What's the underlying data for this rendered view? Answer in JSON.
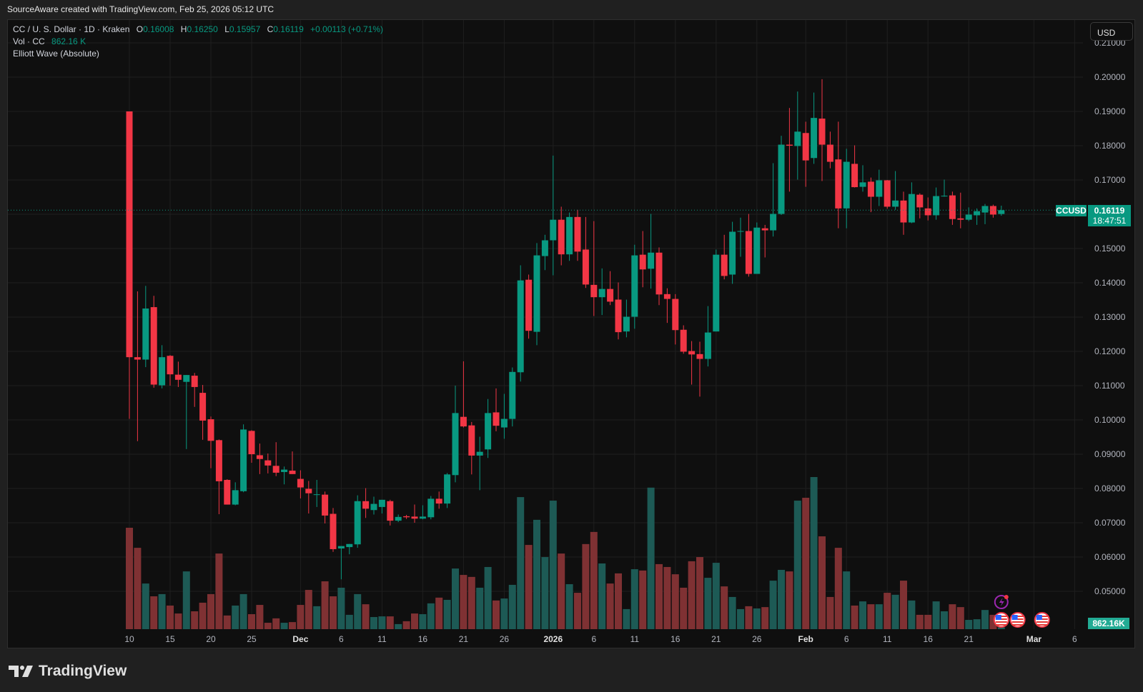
{
  "topbar": {
    "attribution": "SourceAware created with TradingView.com, Feb 25, 2026 05:12 UTC"
  },
  "legend": {
    "symbol_line": "CC / U. S. Dollar · 1D · Kraken",
    "o_label": "O",
    "o": "0.16008",
    "h_label": "H",
    "h": "0.16250",
    "l_label": "L",
    "l": "0.15957",
    "c_label": "C",
    "c": "0.16119",
    "change": "+0.00113 (+0.71%)",
    "vol_label": "Vol · CC",
    "vol": "862.16 K",
    "indicator": "Elliott Wave (Absolute)"
  },
  "currency_button": "USD",
  "last_price": {
    "symbol": "CCUSD",
    "price": "0.16119",
    "countdown": "18:47:51"
  },
  "last_volume": "862.16K",
  "brand": "TradingView",
  "colors": {
    "up": "#089981",
    "down": "#f23645",
    "up_vol": "#1d5a55",
    "down_vol": "#7f3133",
    "bg": "#0f0f0f",
    "grid": "#1f1f1f"
  },
  "chart_data": {
    "type": "candlestick",
    "symbol": "CCUSD",
    "interval": "1D",
    "start_date": "Nov 10 2025",
    "ylim": [
      0.05,
      0.21
    ],
    "yticks": [
      "0.05000",
      "0.06000",
      "0.07000",
      "0.08000",
      "0.09000",
      "0.10000",
      "0.11000",
      "0.12000",
      "0.13000",
      "0.14000",
      "0.15000",
      "0.16000",
      "0.17000",
      "0.18000",
      "0.19000",
      "0.20000",
      "0.21000"
    ],
    "xticks": [
      {
        "label": "10",
        "day": 0
      },
      {
        "label": "15",
        "day": 5
      },
      {
        "label": "20",
        "day": 10
      },
      {
        "label": "25",
        "day": 15
      },
      {
        "label": "Dec",
        "day": 21,
        "major": true
      },
      {
        "label": "6",
        "day": 26
      },
      {
        "label": "11",
        "day": 31
      },
      {
        "label": "16",
        "day": 36
      },
      {
        "label": "21",
        "day": 41
      },
      {
        "label": "26",
        "day": 46
      },
      {
        "label": "2026",
        "day": 52,
        "major": true
      },
      {
        "label": "6",
        "day": 57
      },
      {
        "label": "11",
        "day": 62
      },
      {
        "label": "16",
        "day": 67
      },
      {
        "label": "21",
        "day": 72
      },
      {
        "label": "26",
        "day": 77
      },
      {
        "label": "Feb",
        "day": 83,
        "major": true
      },
      {
        "label": "6",
        "day": 88
      },
      {
        "label": "11",
        "day": 93
      },
      {
        "label": "16",
        "day": 98
      },
      {
        "label": "21",
        "day": 103
      },
      {
        "label": "Mar",
        "day": 111,
        "major": true
      },
      {
        "label": "6",
        "day": 116
      }
    ],
    "ohlc_columns": [
      "open",
      "high",
      "low",
      "close"
    ],
    "ohlc": [
      [
        0.19,
        0.19,
        0.1003,
        0.1183
      ],
      [
        0.1183,
        0.1375,
        0.0938,
        0.1176
      ],
      [
        0.1176,
        0.1391,
        0.1154,
        0.1325
      ],
      [
        0.1329,
        0.1362,
        0.1094,
        0.1103
      ],
      [
        0.1101,
        0.1218,
        0.1092,
        0.1183
      ],
      [
        0.1187,
        0.1189,
        0.11,
        0.1133
      ],
      [
        0.1132,
        0.117,
        0.1096,
        0.1117
      ],
      [
        0.1111,
        0.1131,
        0.0915,
        0.1131
      ],
      [
        0.1129,
        0.1137,
        0.1038,
        0.1096
      ],
      [
        0.1079,
        0.1102,
        0.0942,
        0.0998
      ],
      [
        0.1002,
        0.101,
        0.0859,
        0.0939
      ],
      [
        0.0941,
        0.0943,
        0.0725,
        0.0821
      ],
      [
        0.0825,
        0.0827,
        0.0753,
        0.0753
      ],
      [
        0.0753,
        0.0818,
        0.0751,
        0.0795
      ],
      [
        0.0792,
        0.0987,
        0.0789,
        0.0972
      ],
      [
        0.0968,
        0.097,
        0.0875,
        0.09
      ],
      [
        0.0897,
        0.0931,
        0.0842,
        0.0886
      ],
      [
        0.0882,
        0.0902,
        0.0844,
        0.0867
      ],
      [
        0.0866,
        0.0935,
        0.0836,
        0.0846
      ],
      [
        0.0848,
        0.0864,
        0.0812,
        0.0855
      ],
      [
        0.0852,
        0.0908,
        0.0842,
        0.0842
      ],
      [
        0.0828,
        0.0853,
        0.0771,
        0.0803
      ],
      [
        0.0799,
        0.0822,
        0.0727,
        0.0786
      ],
      [
        0.0782,
        0.0825,
        0.0746,
        0.0783
      ],
      [
        0.0782,
        0.0791,
        0.0698,
        0.0721
      ],
      [
        0.0726,
        0.0743,
        0.0615,
        0.0623
      ],
      [
        0.0625,
        0.0632,
        0.0535,
        0.0632
      ],
      [
        0.0629,
        0.0638,
        0.0608,
        0.0638
      ],
      [
        0.0637,
        0.078,
        0.0627,
        0.0763
      ],
      [
        0.0763,
        0.0801,
        0.0714,
        0.0741
      ],
      [
        0.0737,
        0.0776,
        0.0724,
        0.0755
      ],
      [
        0.0746,
        0.0767,
        0.0727,
        0.0767
      ],
      [
        0.0763,
        0.0767,
        0.0692,
        0.0706
      ],
      [
        0.0706,
        0.0724,
        0.0702,
        0.0717
      ],
      [
        0.0719,
        0.0723,
        0.0711,
        0.0716
      ],
      [
        0.0718,
        0.0753,
        0.07,
        0.0712
      ],
      [
        0.0712,
        0.0751,
        0.071,
        0.0718
      ],
      [
        0.0716,
        0.0778,
        0.071,
        0.077
      ],
      [
        0.077,
        0.0791,
        0.0741,
        0.0756
      ],
      [
        0.0756,
        0.0845,
        0.0743,
        0.0841
      ],
      [
        0.0839,
        0.11,
        0.0818,
        0.102
      ],
      [
        0.1009,
        0.1171,
        0.0978,
        0.0981
      ],
      [
        0.0984,
        0.0994,
        0.0841,
        0.0896
      ],
      [
        0.0896,
        0.0951,
        0.0795,
        0.0907
      ],
      [
        0.0914,
        0.1061,
        0.0889,
        0.102
      ],
      [
        0.1022,
        0.1092,
        0.0967,
        0.0983
      ],
      [
        0.0978,
        0.1076,
        0.0945,
        0.1003
      ],
      [
        0.1003,
        0.1153,
        0.0981,
        0.114
      ],
      [
        0.1139,
        0.1451,
        0.1112,
        0.1407
      ],
      [
        0.1409,
        0.1424,
        0.1237,
        0.126
      ],
      [
        0.1257,
        0.1516,
        0.1218,
        0.148
      ],
      [
        0.1478,
        0.154,
        0.1437,
        0.1524
      ],
      [
        0.1524,
        0.1771,
        0.1422,
        0.1584
      ],
      [
        0.1584,
        0.1622,
        0.1451,
        0.1483
      ],
      [
        0.1483,
        0.1605,
        0.1464,
        0.1592
      ],
      [
        0.1592,
        0.1613,
        0.1464,
        0.1491
      ],
      [
        0.1497,
        0.1592,
        0.1385,
        0.1395
      ],
      [
        0.1394,
        0.158,
        0.1303,
        0.1358
      ],
      [
        0.1358,
        0.1442,
        0.1306,
        0.1382
      ],
      [
        0.1382,
        0.1434,
        0.1335,
        0.1345
      ],
      [
        0.1351,
        0.1401,
        0.1235,
        0.1256
      ],
      [
        0.1258,
        0.1351,
        0.1241,
        0.1301
      ],
      [
        0.1301,
        0.1511,
        0.1266,
        0.148
      ],
      [
        0.1482,
        0.1551,
        0.1387,
        0.1439
      ],
      [
        0.1441,
        0.1601,
        0.1383,
        0.1488
      ],
      [
        0.1488,
        0.1503,
        0.1335,
        0.1366
      ],
      [
        0.1367,
        0.1384,
        0.1283,
        0.1353
      ],
      [
        0.1353,
        0.1367,
        0.122,
        0.1262
      ],
      [
        0.1263,
        0.1276,
        0.1193,
        0.1199
      ],
      [
        0.1201,
        0.123,
        0.1103,
        0.1191
      ],
      [
        0.1192,
        0.1228,
        0.1068,
        0.1178
      ],
      [
        0.1178,
        0.1332,
        0.1156,
        0.1255
      ],
      [
        0.1258,
        0.1497,
        0.1258,
        0.1482
      ],
      [
        0.1482,
        0.154,
        0.141,
        0.142
      ],
      [
        0.1424,
        0.1578,
        0.1397,
        0.1549
      ],
      [
        0.155,
        0.159,
        0.1476,
        0.1551
      ],
      [
        0.1551,
        0.1601,
        0.1418,
        0.1426
      ],
      [
        0.1426,
        0.1576,
        0.1426,
        0.1561
      ],
      [
        0.1559,
        0.1569,
        0.1474,
        0.1553
      ],
      [
        0.1553,
        0.1749,
        0.1535,
        0.1601
      ],
      [
        0.1601,
        0.1829,
        0.1598,
        0.1803
      ],
      [
        0.1803,
        0.191,
        0.1666,
        0.18
      ],
      [
        0.1799,
        0.1958,
        0.1701,
        0.1841
      ],
      [
        0.1837,
        0.187,
        0.168,
        0.1757
      ],
      [
        0.1764,
        0.1955,
        0.1747,
        0.1881
      ],
      [
        0.1879,
        0.1994,
        0.1697,
        0.1803
      ],
      [
        0.1803,
        0.1841,
        0.1734,
        0.1753
      ],
      [
        0.176,
        0.187,
        0.1559,
        0.1617
      ],
      [
        0.1617,
        0.1791,
        0.1559,
        0.1753
      ],
      [
        0.1747,
        0.1801,
        0.1678,
        0.1679
      ],
      [
        0.168,
        0.1743,
        0.1666,
        0.1693
      ],
      [
        0.1695,
        0.1707,
        0.1606,
        0.1651
      ],
      [
        0.1651,
        0.173,
        0.1624,
        0.1699
      ],
      [
        0.1699,
        0.17,
        0.1616,
        0.1622
      ],
      [
        0.1622,
        0.1726,
        0.1613,
        0.164
      ],
      [
        0.164,
        0.1666,
        0.154,
        0.1576
      ],
      [
        0.1576,
        0.1693,
        0.1574,
        0.1659
      ],
      [
        0.1657,
        0.1661,
        0.1588,
        0.162
      ],
      [
        0.1617,
        0.1649,
        0.1582,
        0.1597
      ],
      [
        0.1597,
        0.1678,
        0.1584,
        0.1653
      ],
      [
        0.1653,
        0.1701,
        0.1651,
        0.1654
      ],
      [
        0.1655,
        0.1666,
        0.1569,
        0.1586
      ],
      [
        0.1588,
        0.1663,
        0.1559,
        0.1584
      ],
      [
        0.1584,
        0.162,
        0.158,
        0.1599
      ],
      [
        0.1597,
        0.1617,
        0.1569,
        0.1609
      ],
      [
        0.1605,
        0.163,
        0.1571,
        0.1624
      ],
      [
        0.1624,
        0.1628,
        0.159,
        0.1599
      ],
      [
        0.16008,
        0.1625,
        0.15957,
        0.16119
      ]
    ],
    "volume_unit": "M CC",
    "volume": [
      46.0,
      36.9,
      20.7,
      14.9,
      15.9,
      10.7,
      7.1,
      26.2,
      8.1,
      12.0,
      15.9,
      34.3,
      6.2,
      10.7,
      15.9,
      6.8,
      11.0,
      2.9,
      4.9,
      2.9,
      3.2,
      11.0,
      17.8,
      10.4,
      21.7,
      14.9,
      18.8,
      6.5,
      15.9,
      11.3,
      5.5,
      5.8,
      5.8,
      2.3,
      3.6,
      7.1,
      6.8,
      11.7,
      14.3,
      13.3,
      27.5,
      24.6,
      23.7,
      18.8,
      28.2,
      13.0,
      13.9,
      20.1,
      59.9,
      38.2,
      49.6,
      32.7,
      58.3,
      34.3,
      20.4,
      16.5,
      38.6,
      44.1,
      29.8,
      20.7,
      25.3,
      9.1,
      27.2,
      26.6,
      64.2,
      29.5,
      28.2,
      24.9,
      18.8,
      30.8,
      32.7,
      23.3,
      30.1,
      19.4,
      14.6,
      9.1,
      10.4,
      9.4,
      10.0,
      22.0,
      26.9,
      26.2,
      58.3,
      59.6,
      69.0,
      42.1,
      14.6,
      36.9,
      26.2,
      10.7,
      12.6,
      11.3,
      11.3,
      16.5,
      15.6,
      22.0,
      13.0,
      6.5,
      6.5,
      12.6,
      8.1,
      11.3,
      10.0,
      4.2,
      4.5,
      8.7,
      6.5,
      0.86
    ],
    "events": [
      {
        "type": "lightning",
        "day": 107
      },
      {
        "type": "us-flag",
        "day": 107
      },
      {
        "type": "us-flag",
        "day": 109
      },
      {
        "type": "us-flag",
        "day": 112
      }
    ]
  }
}
